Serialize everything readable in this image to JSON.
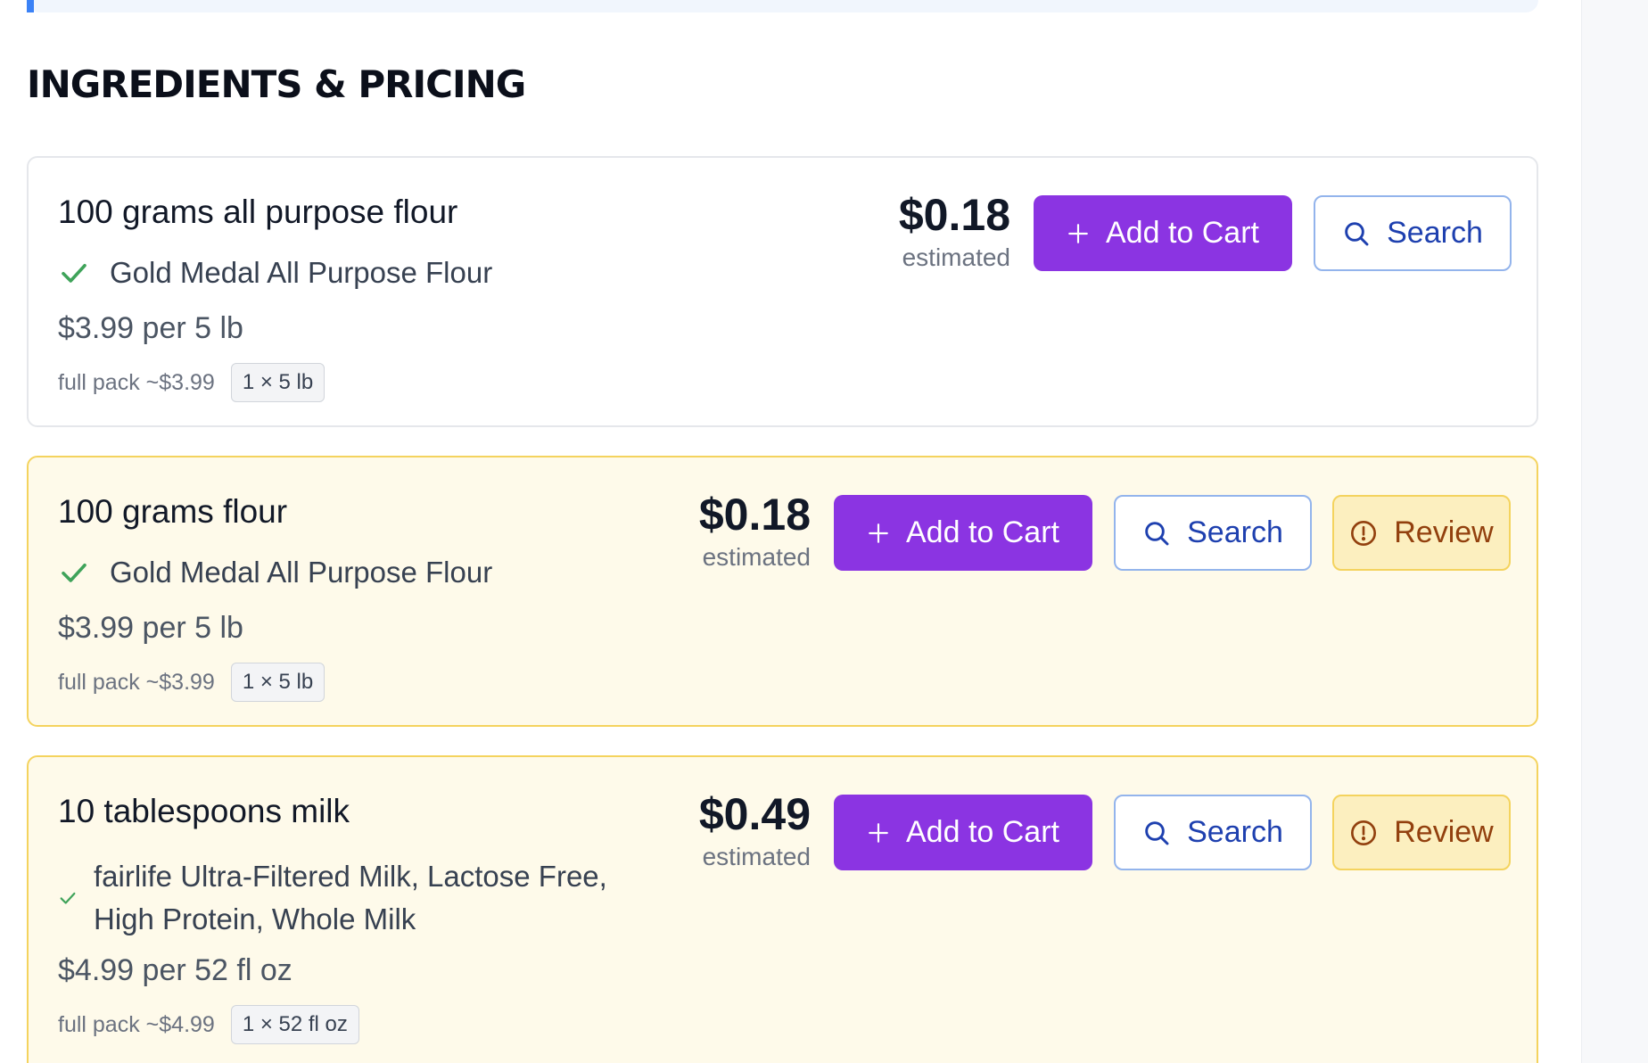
{
  "section": {
    "title": "INGREDIENTS & PRICING"
  },
  "labels": {
    "add_to_cart": "Add to Cart",
    "search": "Search",
    "review": "Review",
    "estimated": "estimated"
  },
  "colors": {
    "primary": "#8b34e2",
    "search_border": "#93b4ec",
    "warning_bg": "#fefaea",
    "warning_border": "#f4d35e",
    "check": "#3fa35a"
  },
  "items": [
    {
      "title": "100 grams all purpose flour",
      "product": "Gold Medal All Purpose Flour",
      "unit_price": "$3.99 per 5 lb",
      "full_pack": "full pack ~$3.99",
      "pack_badge": "1 × 5 lb",
      "price": "$0.18",
      "needs_review": false
    },
    {
      "title": "100 grams flour",
      "product": "Gold Medal All Purpose Flour",
      "unit_price": "$3.99 per 5 lb",
      "full_pack": "full pack ~$3.99",
      "pack_badge": "1 × 5 lb",
      "price": "$0.18",
      "needs_review": true
    },
    {
      "title": "10 tablespoons milk",
      "product": "fairlife Ultra-Filtered Milk, Lactose Free, High Protein, Whole Milk",
      "unit_price": "$4.99 per 52 fl oz",
      "full_pack": "full pack ~$4.99",
      "pack_badge": "1 × 52 fl oz",
      "price": "$0.49",
      "needs_review": true
    }
  ]
}
